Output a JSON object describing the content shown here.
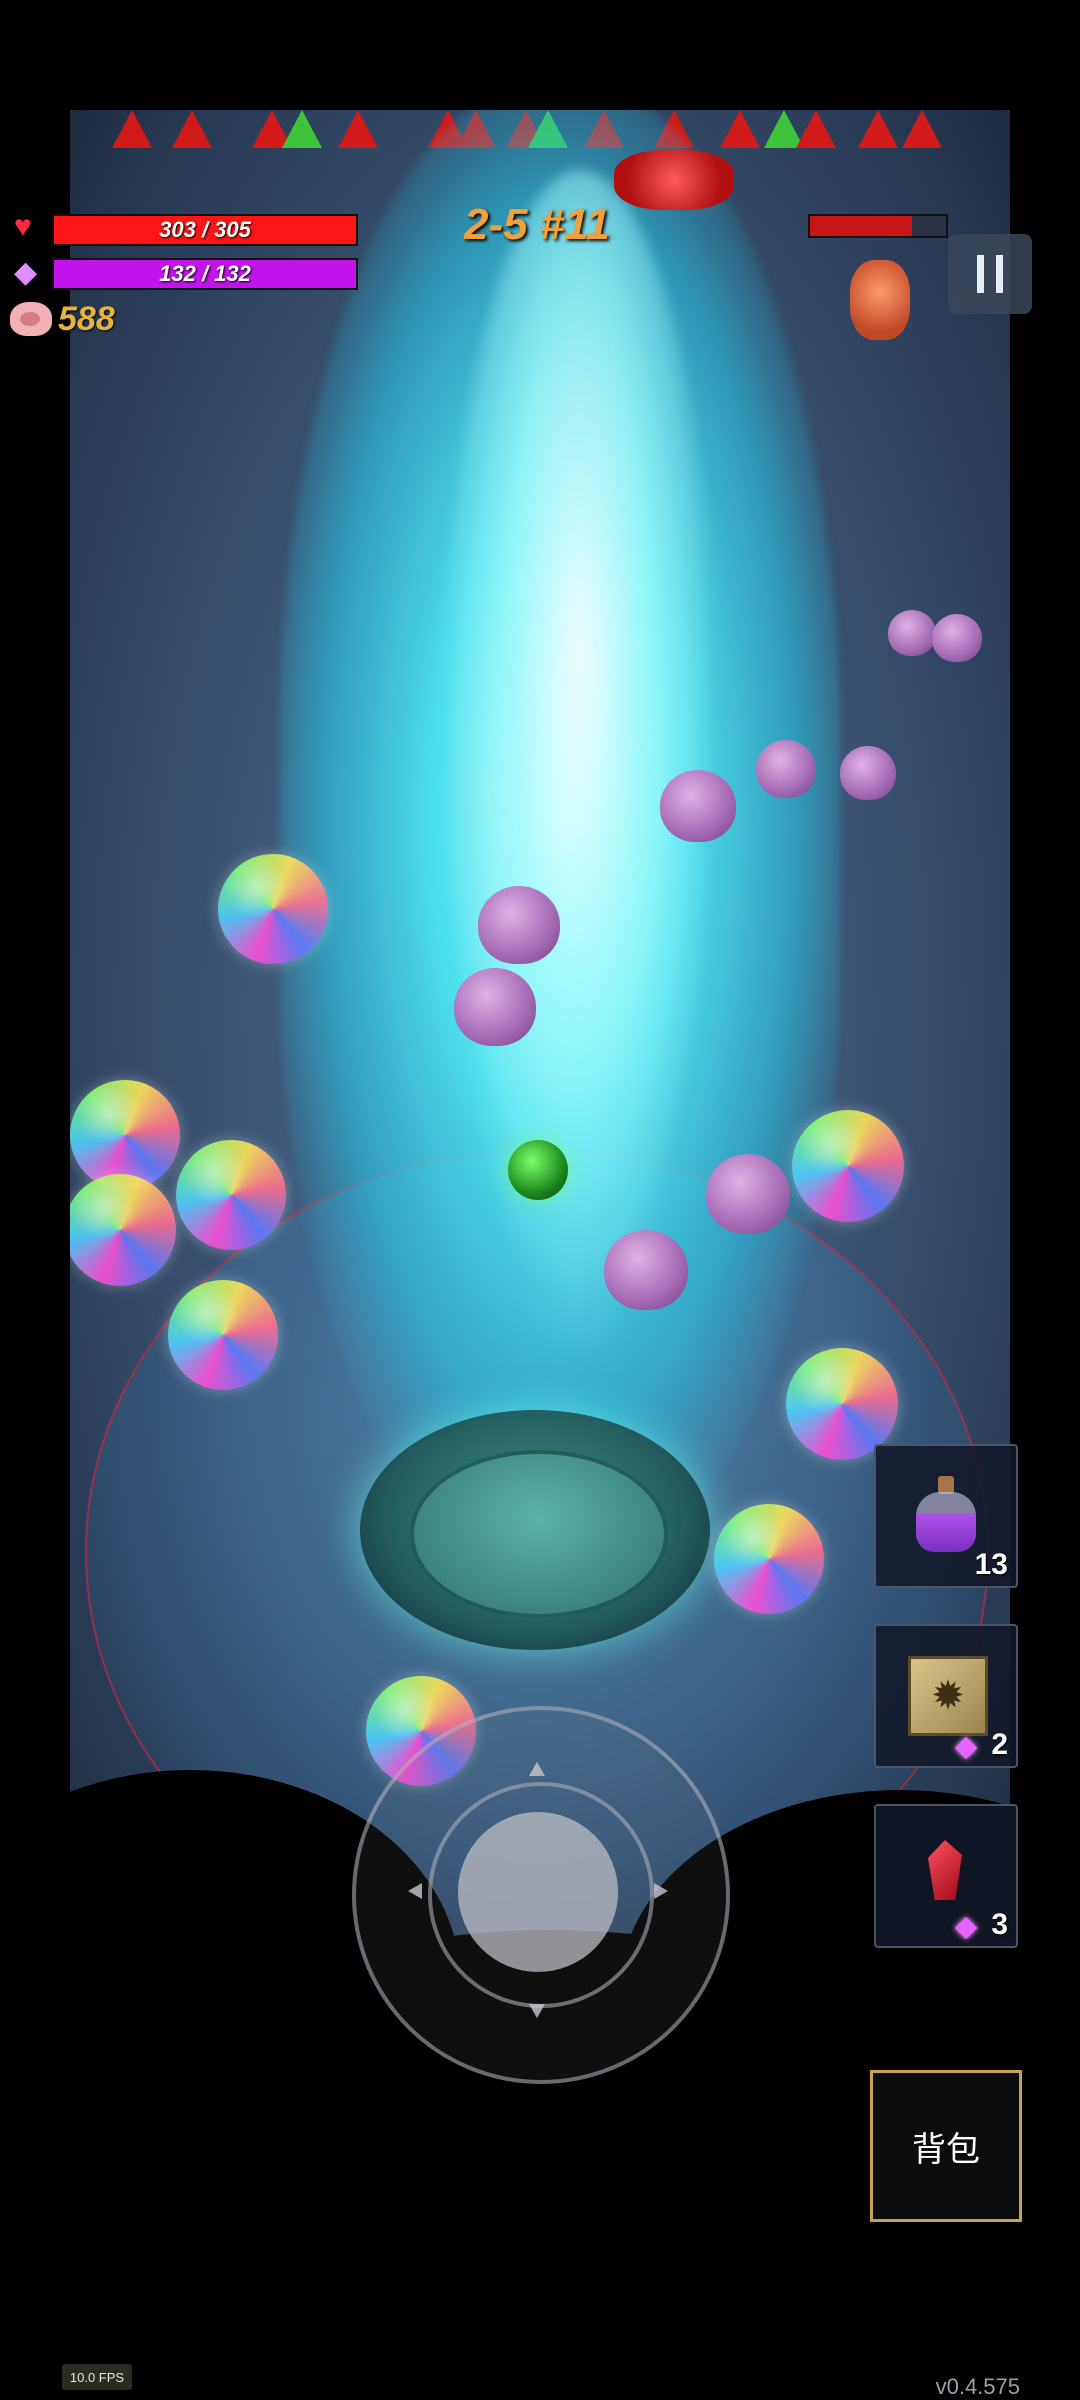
{
  "hud": {
    "hp_text": "303 / 305",
    "mp_text": "132 / 132",
    "coins": "588",
    "stage": "2-5 #11",
    "hp_current": 303,
    "hp_max": 305,
    "mp_current": 132,
    "mp_max": 132,
    "boss_hp_fraction": 0.75
  },
  "items": {
    "potion_count": "13",
    "rune_box_cost": "2",
    "crystal_cost": "3"
  },
  "buttons": {
    "bag_label": "背包"
  },
  "footer": {
    "fps": "10.0 FPS",
    "version": "v0.4.575"
  },
  "icons": {
    "hp": "heart-icon",
    "mp": "gem-icon",
    "coins": "pig-icon",
    "pause": "pause-icon",
    "potion": "potion-icon",
    "rune_box": "rune-box-icon",
    "crystal": "red-crystal-icon"
  },
  "colors": {
    "hp_bar": "#ff1515",
    "mp_bar": "#c314ec",
    "stage_text": "#f0a13a",
    "coin_text": "#e7b33c",
    "beam": "#50f0fa",
    "bag_border": "#c9a24a"
  }
}
